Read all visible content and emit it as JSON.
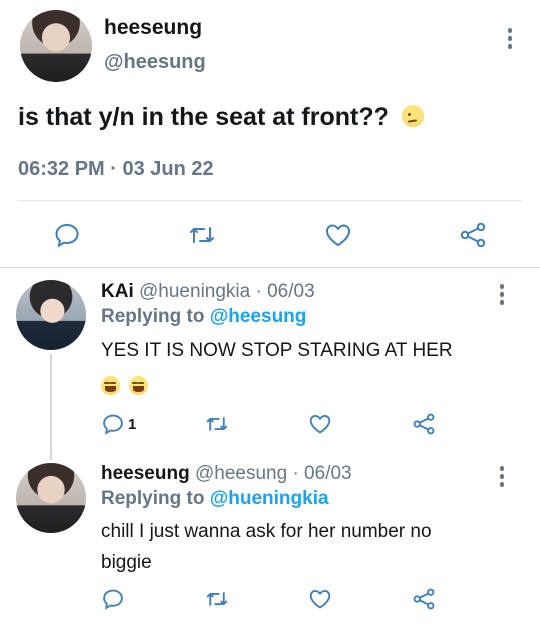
{
  "main_tweet": {
    "name": "heeseung",
    "handle": "@heesung",
    "text": "is that y/n in the seat at front??",
    "text_emoji": "face-with-raised-eyebrow",
    "timestamp": "06:32 PM · 03 Jun 22",
    "actions": [
      "reply-icon",
      "retweet-icon",
      "like-icon",
      "share-icon"
    ]
  },
  "replies": [
    {
      "name": "KAi",
      "meta": "@hueningkia · 06/03",
      "replying_prefix": "Replying to",
      "replying_to": "@heesung",
      "text_line1": "YES IT IS NOW STOP STARING AT HER",
      "emojis": [
        "grinning-squinting-face",
        "grinning-squinting-face"
      ],
      "reply_count": "1"
    },
    {
      "name": "heeseung",
      "meta": "@heesung · 06/03",
      "replying_prefix": "Replying to",
      "replying_to": "@hueningkia",
      "text_line1": "chill I just wanna ask for her number no",
      "text_line2": "biggie"
    }
  ],
  "colors": {
    "text": "#14171a",
    "secondary": "#657786",
    "accent": "#1da1f2",
    "divider": "#e1e8ed"
  }
}
